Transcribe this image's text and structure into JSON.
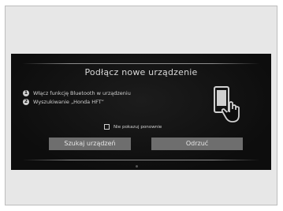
{
  "dialog": {
    "title": "Podłącz nowe urządzenie",
    "steps": [
      {
        "number": "1",
        "text": "Włącz funkcję Bluetooth w urządzeniu"
      },
      {
        "number": "2",
        "text": "Wyszukiwanie „Honda HFT”"
      }
    ],
    "checkbox": {
      "label": "Nie pokazuj ponownie",
      "checked": false
    },
    "buttons": {
      "search": "Szukaj urządzeń",
      "reject": "Odrzuć"
    },
    "illustration_icon": "phone-touch-icon"
  },
  "colors": {
    "screen_bg": "#101010",
    "text": "#d8d8d8",
    "button_bg": "#6e6e6e",
    "frame_bg": "#e7e7e7"
  }
}
